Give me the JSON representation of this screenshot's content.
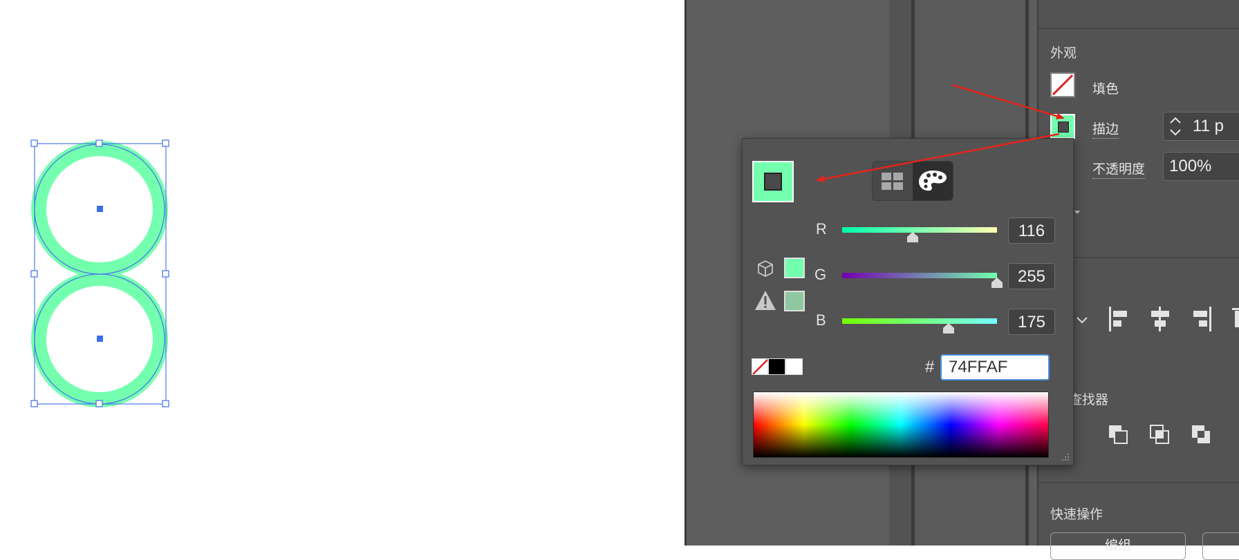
{
  "appearance": {
    "heading": "外观",
    "fill_label": "填色",
    "stroke_label": "描边",
    "stroke_weight": "11 p",
    "opacity_label": "不透明度",
    "opacity_value": "100%"
  },
  "pathfinder": {
    "heading": "查找器"
  },
  "quick_actions": {
    "heading": "快速操作",
    "button_label": "编组"
  },
  "color_picker": {
    "channels": [
      {
        "label": "R",
        "value": "116"
      },
      {
        "label": "G",
        "value": "255"
      },
      {
        "label": "B",
        "value": "175"
      }
    ],
    "channel_levels": {
      "R": 116,
      "G": 255,
      "B": 175,
      "max": 255
    },
    "hex_prefix": "#",
    "hex_value": "74FFAF"
  },
  "colors": {
    "stroke_color": "#74FFAF",
    "web_safe_color": "#8FC8A0",
    "selection_blue": "#4a7ae8",
    "annotation_red": "#e8231a",
    "panel_bg": "#535353"
  },
  "icons": {
    "swatches_mode": "grid-swatches-icon",
    "color_mixer_mode": "palette-icon",
    "gamut_cube": "cube-icon",
    "gamut_warning": "warning-icon"
  }
}
